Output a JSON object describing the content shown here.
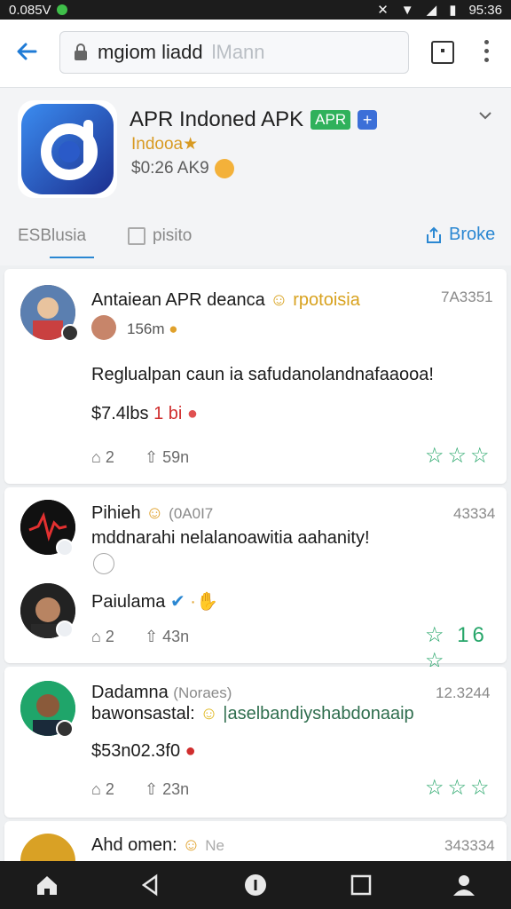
{
  "status_bar": {
    "left_text": "0.085V",
    "time": "95:36"
  },
  "browser": {
    "url_text": "mgiom liadd",
    "url_placeholder": "lMann"
  },
  "app": {
    "title": "APR Indoned APK",
    "badge": "APR",
    "developer": "Indooa★",
    "price": "$0:26 AK9"
  },
  "tabs": [
    {
      "label": "ESBlusia"
    },
    {
      "label": "pisito"
    },
    {
      "label": "Broke"
    }
  ],
  "posts": [
    {
      "name": "Antaiean APR deanca",
      "tag": "rpotoisia",
      "time": "7A3351",
      "sub": "156m",
      "text": "Reglualpan caun ia safudanolandnafaaooa!",
      "price": "$7.4lbs",
      "price_tag": "1 bi",
      "likes": "2",
      "shares": "59n",
      "stars": "☆☆☆"
    },
    {
      "name": "Pihieh",
      "tag": "(0A0I7",
      "time": "43334",
      "text": "mddnarahi nelalanoawitia aahanity!",
      "reply_name": "Paiulama",
      "likes": "2",
      "shares": "43n",
      "stars": "☆ 16 ☆"
    },
    {
      "name": "Dadamna",
      "tag": "(Noraes)",
      "time": "12.3244",
      "text_prefix": "bawonsastal:",
      "text": "|aselbandiyshabdonaaip",
      "price": "$53n02.3f0",
      "likes": "2",
      "shares": "23n",
      "stars": "☆☆☆"
    },
    {
      "name": "Ahd omen:",
      "tag": "Ne",
      "time": "343334"
    }
  ],
  "colors": {
    "accent": "#2a87d2",
    "green": "#27a66a",
    "gold": "#d89a22"
  }
}
